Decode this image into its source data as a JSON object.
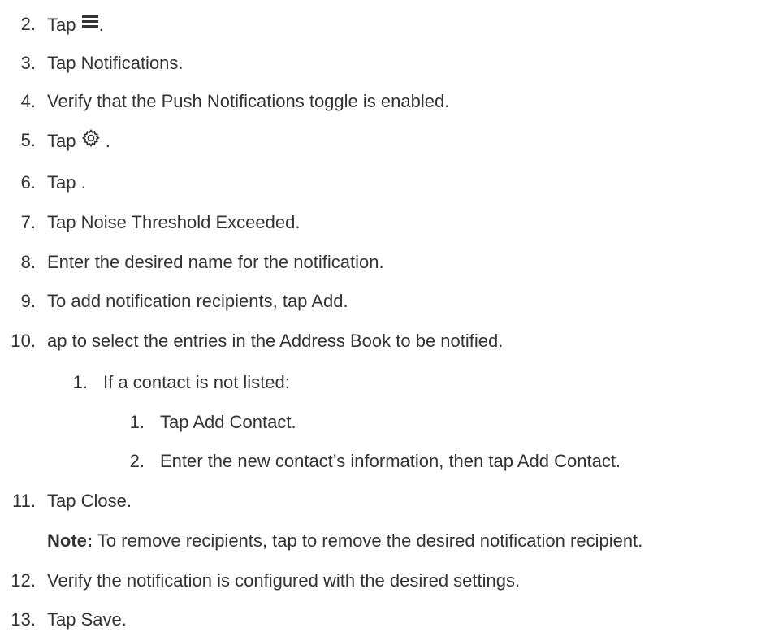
{
  "steps": [
    {
      "num": "2.",
      "pre": "Tap ",
      "icon": "menu-icon",
      "post": "."
    },
    {
      "num": "3.",
      "text": "Tap Notifications."
    },
    {
      "num": "4.",
      "text": "Verify that the Push Notifications toggle is enabled."
    },
    {
      "num": "5.",
      "pre": "Tap ",
      "icon": "gear-icon",
      "post": " ."
    },
    {
      "num": "6.",
      "text": "Tap ."
    },
    {
      "num": "7.",
      "text": "Tap Noise Threshold Exceeded."
    },
    {
      "num": "8.",
      "text": "Enter the desired name for the notification."
    },
    {
      "num": "9.",
      "text": "To add notification recipients, tap Add."
    },
    {
      "num": "10.",
      "text": "ap to select the entries in the Address Book to be notified."
    },
    {
      "num": "1.",
      "text": "If a contact is not listed:"
    },
    {
      "num": "1.",
      "text": "Tap Add Contact."
    },
    {
      "num": "2.",
      "text": "Enter the new contact’s information, then tap Add Contact."
    },
    {
      "num": "11.",
      "text": "Tap Close."
    },
    {
      "num": "12.",
      "text": "Verify the notification is configured with the desired settings."
    },
    {
      "num": "13.",
      "text": "Tap Save."
    }
  ],
  "note": {
    "label": "Note:",
    "text": " To remove recipients, tap to remove the desired notification recipient."
  }
}
